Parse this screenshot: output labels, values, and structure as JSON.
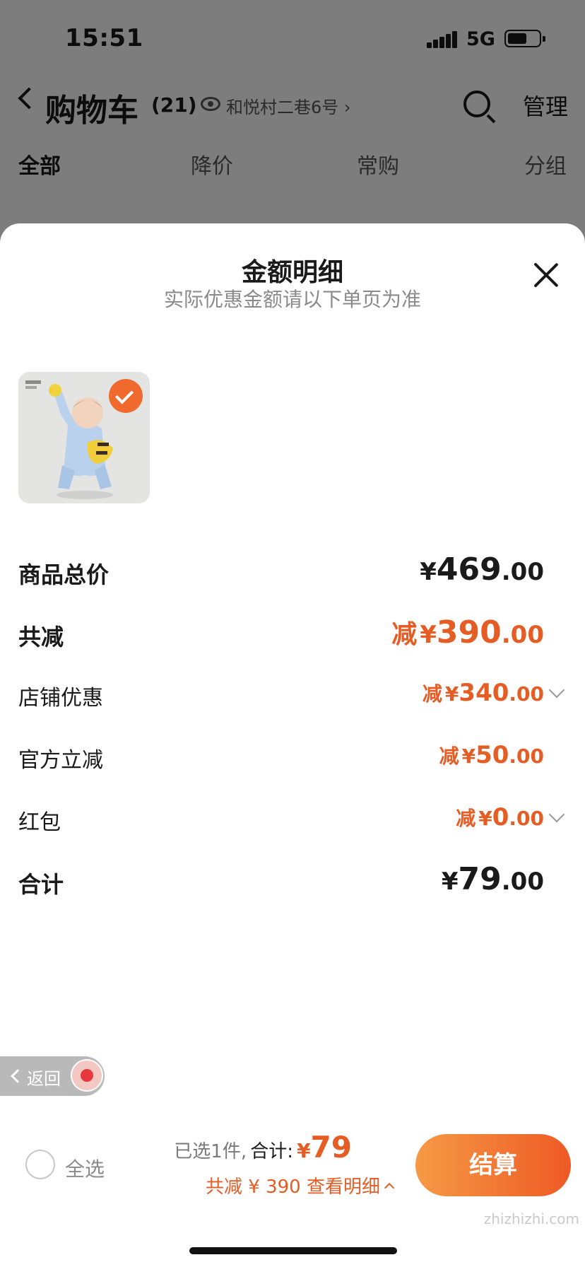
{
  "status_bar": {
    "time": "15:51",
    "network": "5G",
    "battery_level": 0.55
  },
  "header": {
    "back_icon": "chevron-left-icon",
    "title": "购物车",
    "count": "(21)",
    "address_icon": "eye-icon",
    "address": "和悦村二巷6号 ›",
    "search_icon": "search-icon",
    "manage_label": "管理"
  },
  "tabs": [
    {
      "label": "全部",
      "active": true
    },
    {
      "label": "降价",
      "active": false
    },
    {
      "label": "常购",
      "active": false
    },
    {
      "label": "分组",
      "active": false
    }
  ],
  "sheet": {
    "title": "金额明细",
    "subtitle": "实际优惠金额请以下单页为准",
    "close_icon": "close-icon",
    "product_selected": true,
    "rows": {
      "subtotal": {
        "label": "商品总价",
        "yen": "¥",
        "int": "469",
        "dec": ".00"
      },
      "total_discount": {
        "label": "共减",
        "prefix": "减",
        "yen": "¥",
        "int": "390",
        "dec": ".00"
      },
      "store_discount": {
        "label": "店铺优惠",
        "prefix": "减",
        "yen": "¥",
        "int": "340",
        "dec": ".00"
      },
      "official_discount": {
        "label": "官方立减",
        "prefix": "减",
        "yen": "¥",
        "int": "50",
        "dec": ".00"
      },
      "red_packet": {
        "label": "红包",
        "prefix": "减",
        "yen": "¥",
        "int": "0",
        "dec": ".00"
      },
      "total": {
        "label": "合计",
        "yen": "¥",
        "int": "79",
        "dec": ".00"
      }
    }
  },
  "back_pill": {
    "label": "返回"
  },
  "bottom_bar": {
    "select_all": "全选",
    "selected_text": "已选1件,",
    "total_label": "合计:",
    "yen": "¥",
    "total_value": "79",
    "discount_text": "共减 ¥ 390  查看明细",
    "checkout": "结算"
  },
  "watermark": "zhizhizhi.com",
  "colors": {
    "accent": "#e55d24",
    "checkout_start": "#f59a45",
    "checkout_end": "#ee5a25"
  }
}
